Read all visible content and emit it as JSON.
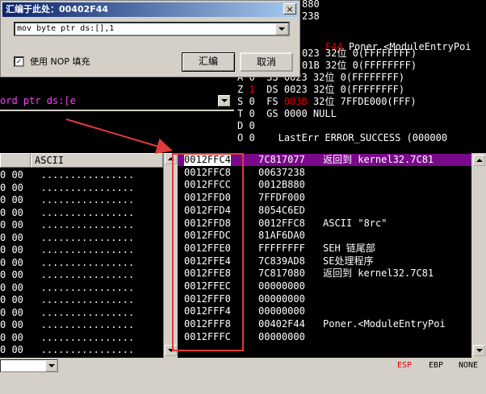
{
  "dialog": {
    "title": "汇编于此处：00402F44",
    "close_label": "×",
    "input_value": "mov byte ptr ds:[],1",
    "nop_fill_label": "使用 NOP 填充",
    "nop_checked_mark": "✓",
    "assemble_label": "汇编",
    "cancel_label": "取消"
  },
  "disasm": {
    "line": "ord ptr ds:[e"
  },
  "registers": {
    "top_values": [
      "880",
      "238"
    ],
    "eip_line": {
      "addr": "F44",
      "text": "Poner.<ModuleEntryPoi"
    },
    "seg_lines": [
      {
        "text": "023 32位 0(FFFFFFFF)"
      },
      {
        "text": "01B 32位 0(FFFFFFFF)"
      },
      {
        "prefix": "A 0  SS",
        "text": "0023 32位 0(FFFFFFFF)"
      },
      {
        "prefix": "Z",
        "flag": "1",
        "mid": "DS",
        "text": "0023 32位 0(FFFFFFFF)"
      },
      {
        "prefix": "S 0  FS",
        "red": "003B",
        "text": "32位 7FFDE000(FFF)"
      },
      {
        "prefix": "T 0  GS",
        "text": "0000 NULL"
      },
      {
        "prefix": "D 0",
        "text": ""
      },
      {
        "prefix": "O 0",
        "text": "LastErr ERROR_SUCCESS (000000"
      }
    ]
  },
  "dump": {
    "header_ascii": "ASCII",
    "rows": [
      {
        "hex": "0 00",
        "ascii": "................"
      },
      {
        "hex": "0 00",
        "ascii": "................"
      },
      {
        "hex": "0 00",
        "ascii": "................"
      },
      {
        "hex": "0 00",
        "ascii": "................"
      },
      {
        "hex": "0 00",
        "ascii": "................"
      },
      {
        "hex": "0 00",
        "ascii": "................"
      },
      {
        "hex": "0 00",
        "ascii": "................"
      },
      {
        "hex": "0 00",
        "ascii": "................"
      },
      {
        "hex": "0 00",
        "ascii": "................"
      },
      {
        "hex": "0 00",
        "ascii": "................"
      },
      {
        "hex": "0 00",
        "ascii": "................"
      },
      {
        "hex": "0 00",
        "ascii": "................"
      },
      {
        "hex": "0 00",
        "ascii": "................"
      },
      {
        "hex": "0 00",
        "ascii": "................"
      },
      {
        "hex": "0 00",
        "ascii": "................"
      }
    ]
  },
  "stack": {
    "rows": [
      {
        "addr": "0012FFC4",
        "value": "7C817077",
        "comment": "返回到 kernel32.7C81"
      },
      {
        "addr": "0012FFC8",
        "value": "00637238",
        "comment": ""
      },
      {
        "addr": "0012FFCC",
        "value": "0012B880",
        "comment": ""
      },
      {
        "addr": "0012FFD0",
        "value": "7FFDF000",
        "comment": ""
      },
      {
        "addr": "0012FFD4",
        "value": "8054C6ED",
        "comment": ""
      },
      {
        "addr": "0012FFD8",
        "value": "0012FFC8",
        "comment": "ASCII \"8rc\""
      },
      {
        "addr": "0012FFDC",
        "value": "81AF6DA0",
        "comment": ""
      },
      {
        "addr": "0012FFE0",
        "value": "FFFFFFFF",
        "comment": "SEH 链尾部"
      },
      {
        "addr": "0012FFE4",
        "value": "7C839AD8",
        "comment": "SE处理程序"
      },
      {
        "addr": "0012FFE8",
        "value": "7C817080",
        "comment": "返回到 kernel32.7C81"
      },
      {
        "addr": "0012FFEC",
        "value": "00000000",
        "comment": ""
      },
      {
        "addr": "0012FFF0",
        "value": "00000000",
        "comment": ""
      },
      {
        "addr": "0012FFF4",
        "value": "00000000",
        "comment": ""
      },
      {
        "addr": "0012FFF8",
        "value": "00402F44",
        "comment": "Poner.<ModuleEntryPoi"
      },
      {
        "addr": "0012FFFC",
        "value": "00000000",
        "comment": ""
      }
    ]
  },
  "statusbar": {
    "esp": "ESP",
    "ebp": "EBP",
    "none": "NONE"
  },
  "colors": {
    "annotation_red": "#e23b3b",
    "selection_purple": "#7a0a8a",
    "register_red": "#e00000"
  },
  "icons": [
    "close-icon",
    "dropdown-arrow-icon",
    "scroll-up-icon",
    "scroll-down-icon",
    "checkmark-icon"
  ]
}
